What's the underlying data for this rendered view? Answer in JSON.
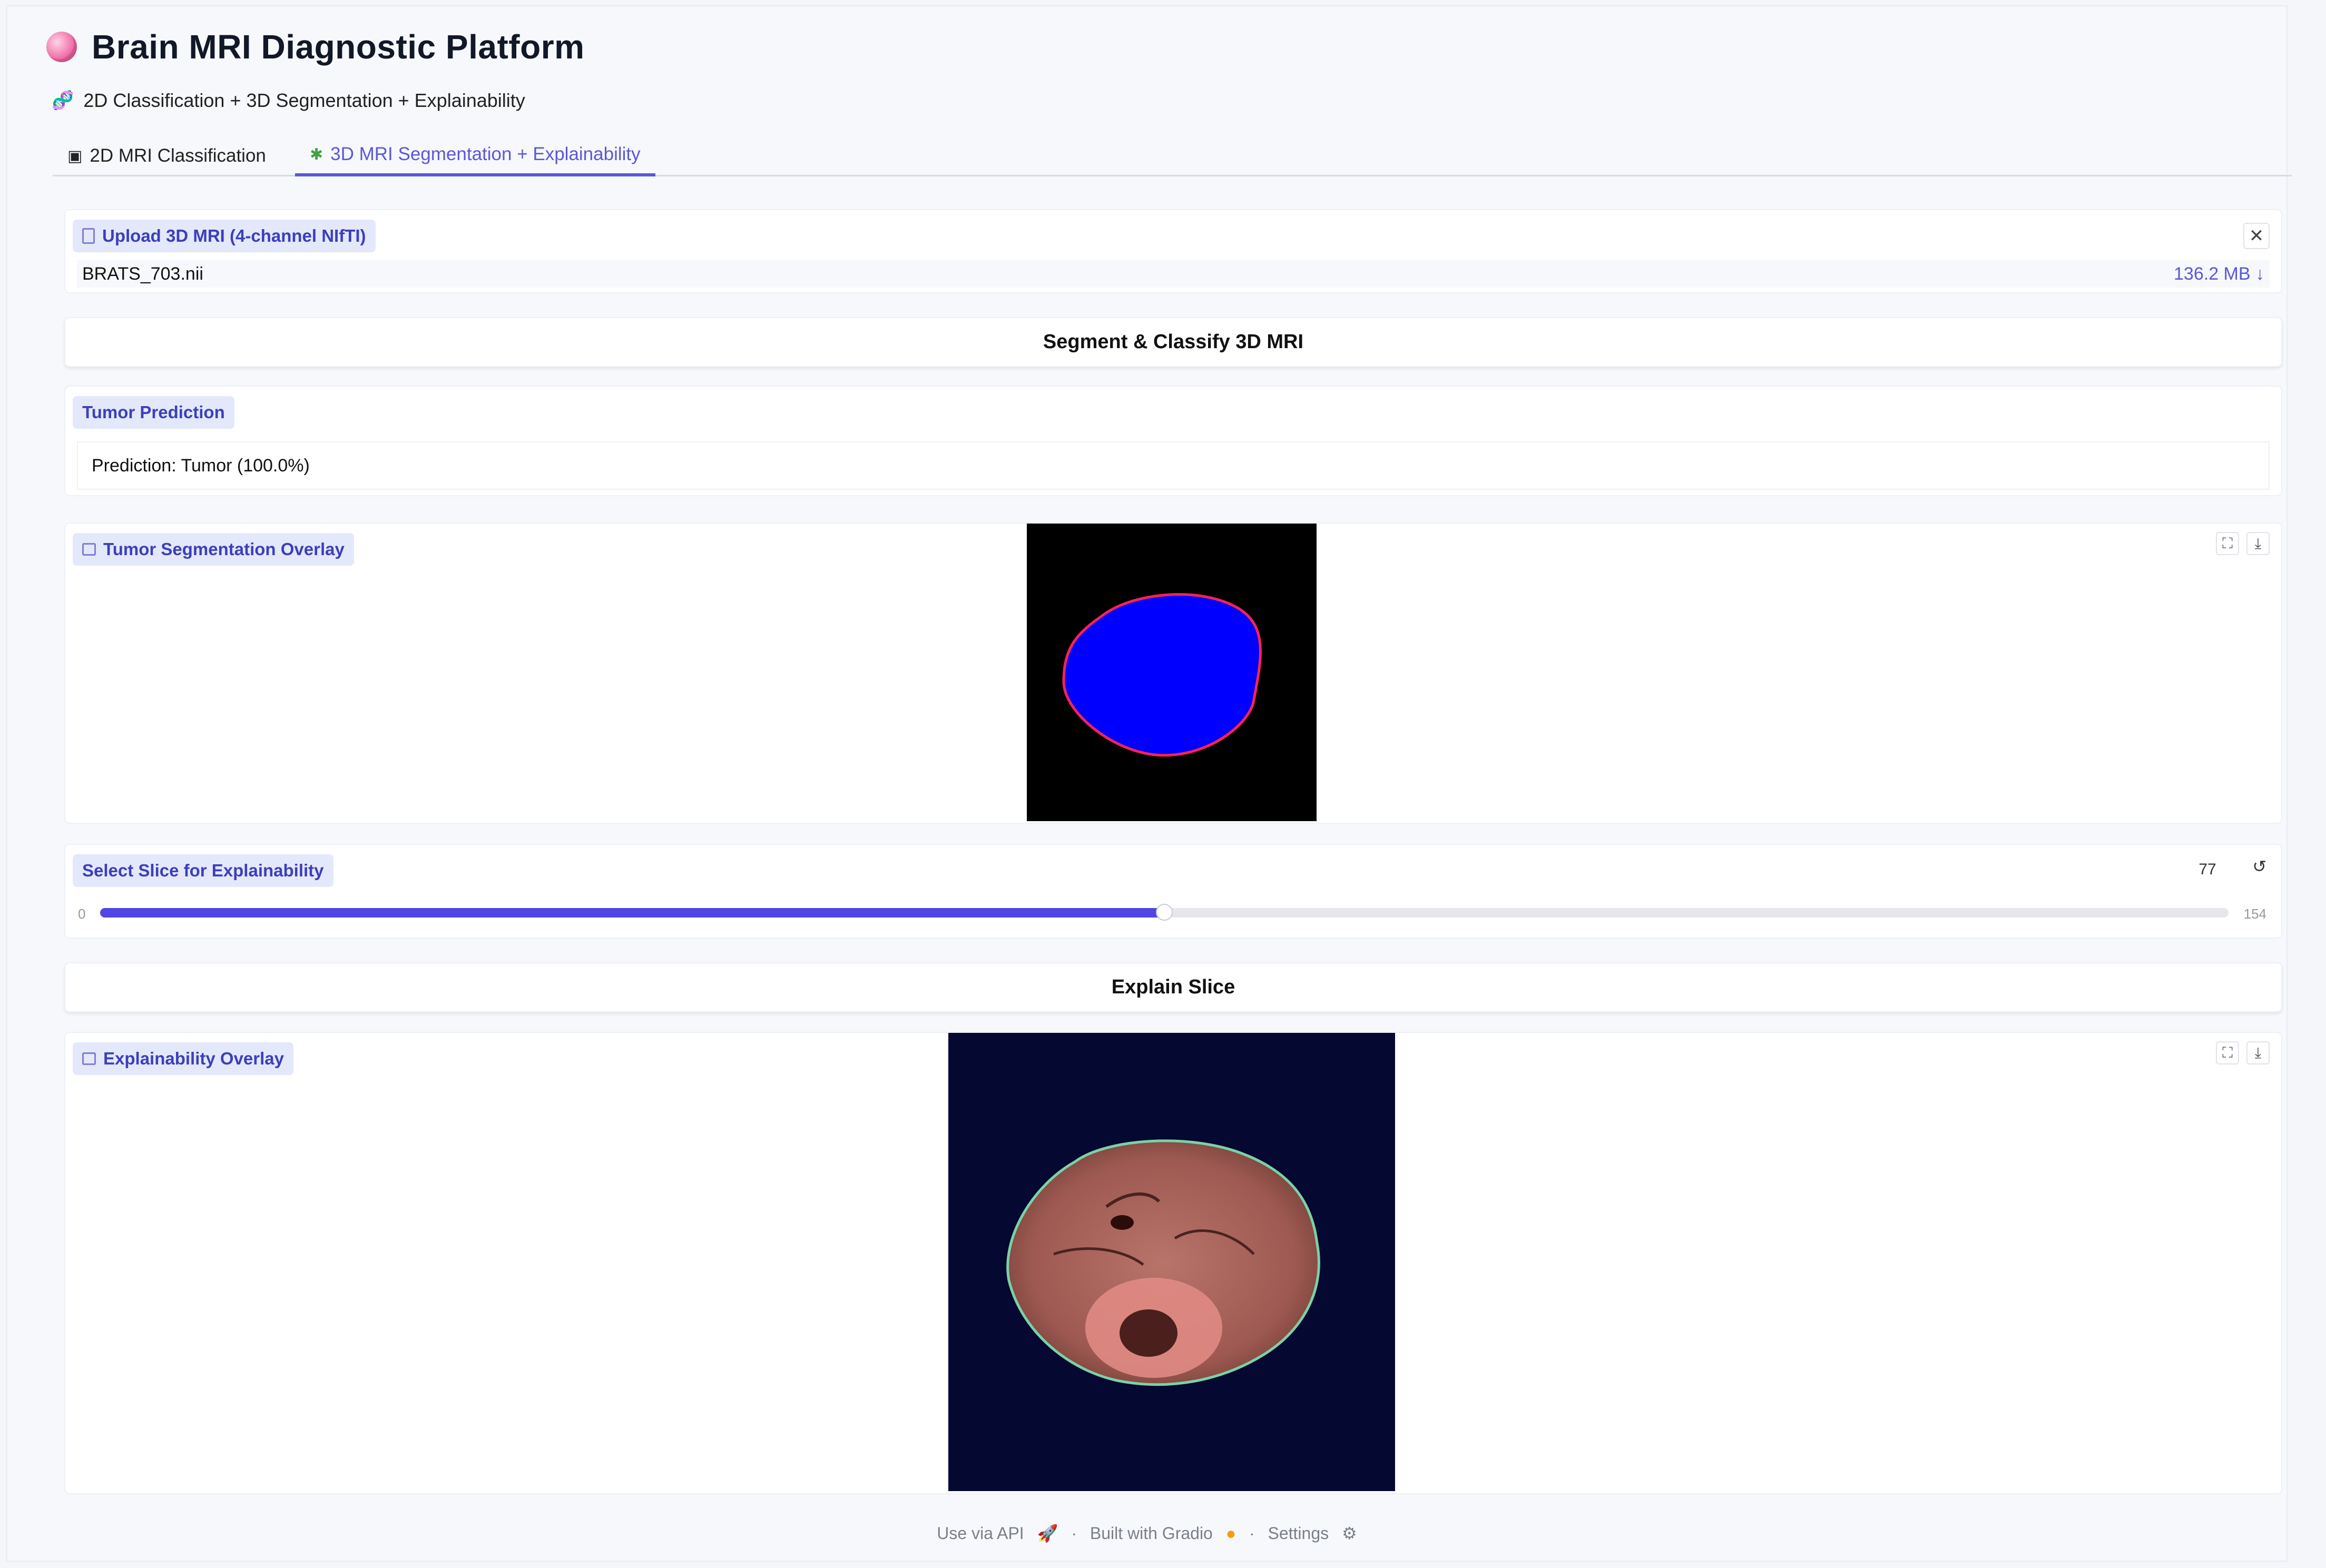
{
  "header": {
    "title": "Brain MRI Diagnostic Platform",
    "subtitle": "2D Classification + 3D Segmentation + Explainability"
  },
  "tabs": [
    {
      "label": "2D MRI Classification",
      "active": false
    },
    {
      "label": "3D MRI Segmentation + Explainability",
      "active": true
    }
  ],
  "upload": {
    "label": "Upload 3D MRI (4-channel NIfTI)",
    "file_name": "BRATS_703.nii",
    "file_size": "136.2 MB ↓"
  },
  "buttons": {
    "segment": "Segment & Classify 3D MRI",
    "explain": "Explain Slice"
  },
  "prediction": {
    "label": "Tumor Prediction",
    "text": "Prediction: Tumor (100.0%)"
  },
  "segmentation": {
    "label": "Tumor Segmentation Overlay"
  },
  "slider": {
    "label": "Select Slice for Explainability",
    "min": "0",
    "max": "154",
    "value": "77",
    "fraction": 0.5
  },
  "explainability": {
    "label": "Explainability Overlay"
  },
  "footer": {
    "api": "Use via API",
    "built": "Built with Gradio",
    "settings": "Settings"
  },
  "colors": {
    "accent": "#4f46e5",
    "badge_bg": "#e4e8fb",
    "badge_text": "#3b3fbb",
    "seg_blue": "#0000ff",
    "seg_red": "#ff2255"
  }
}
